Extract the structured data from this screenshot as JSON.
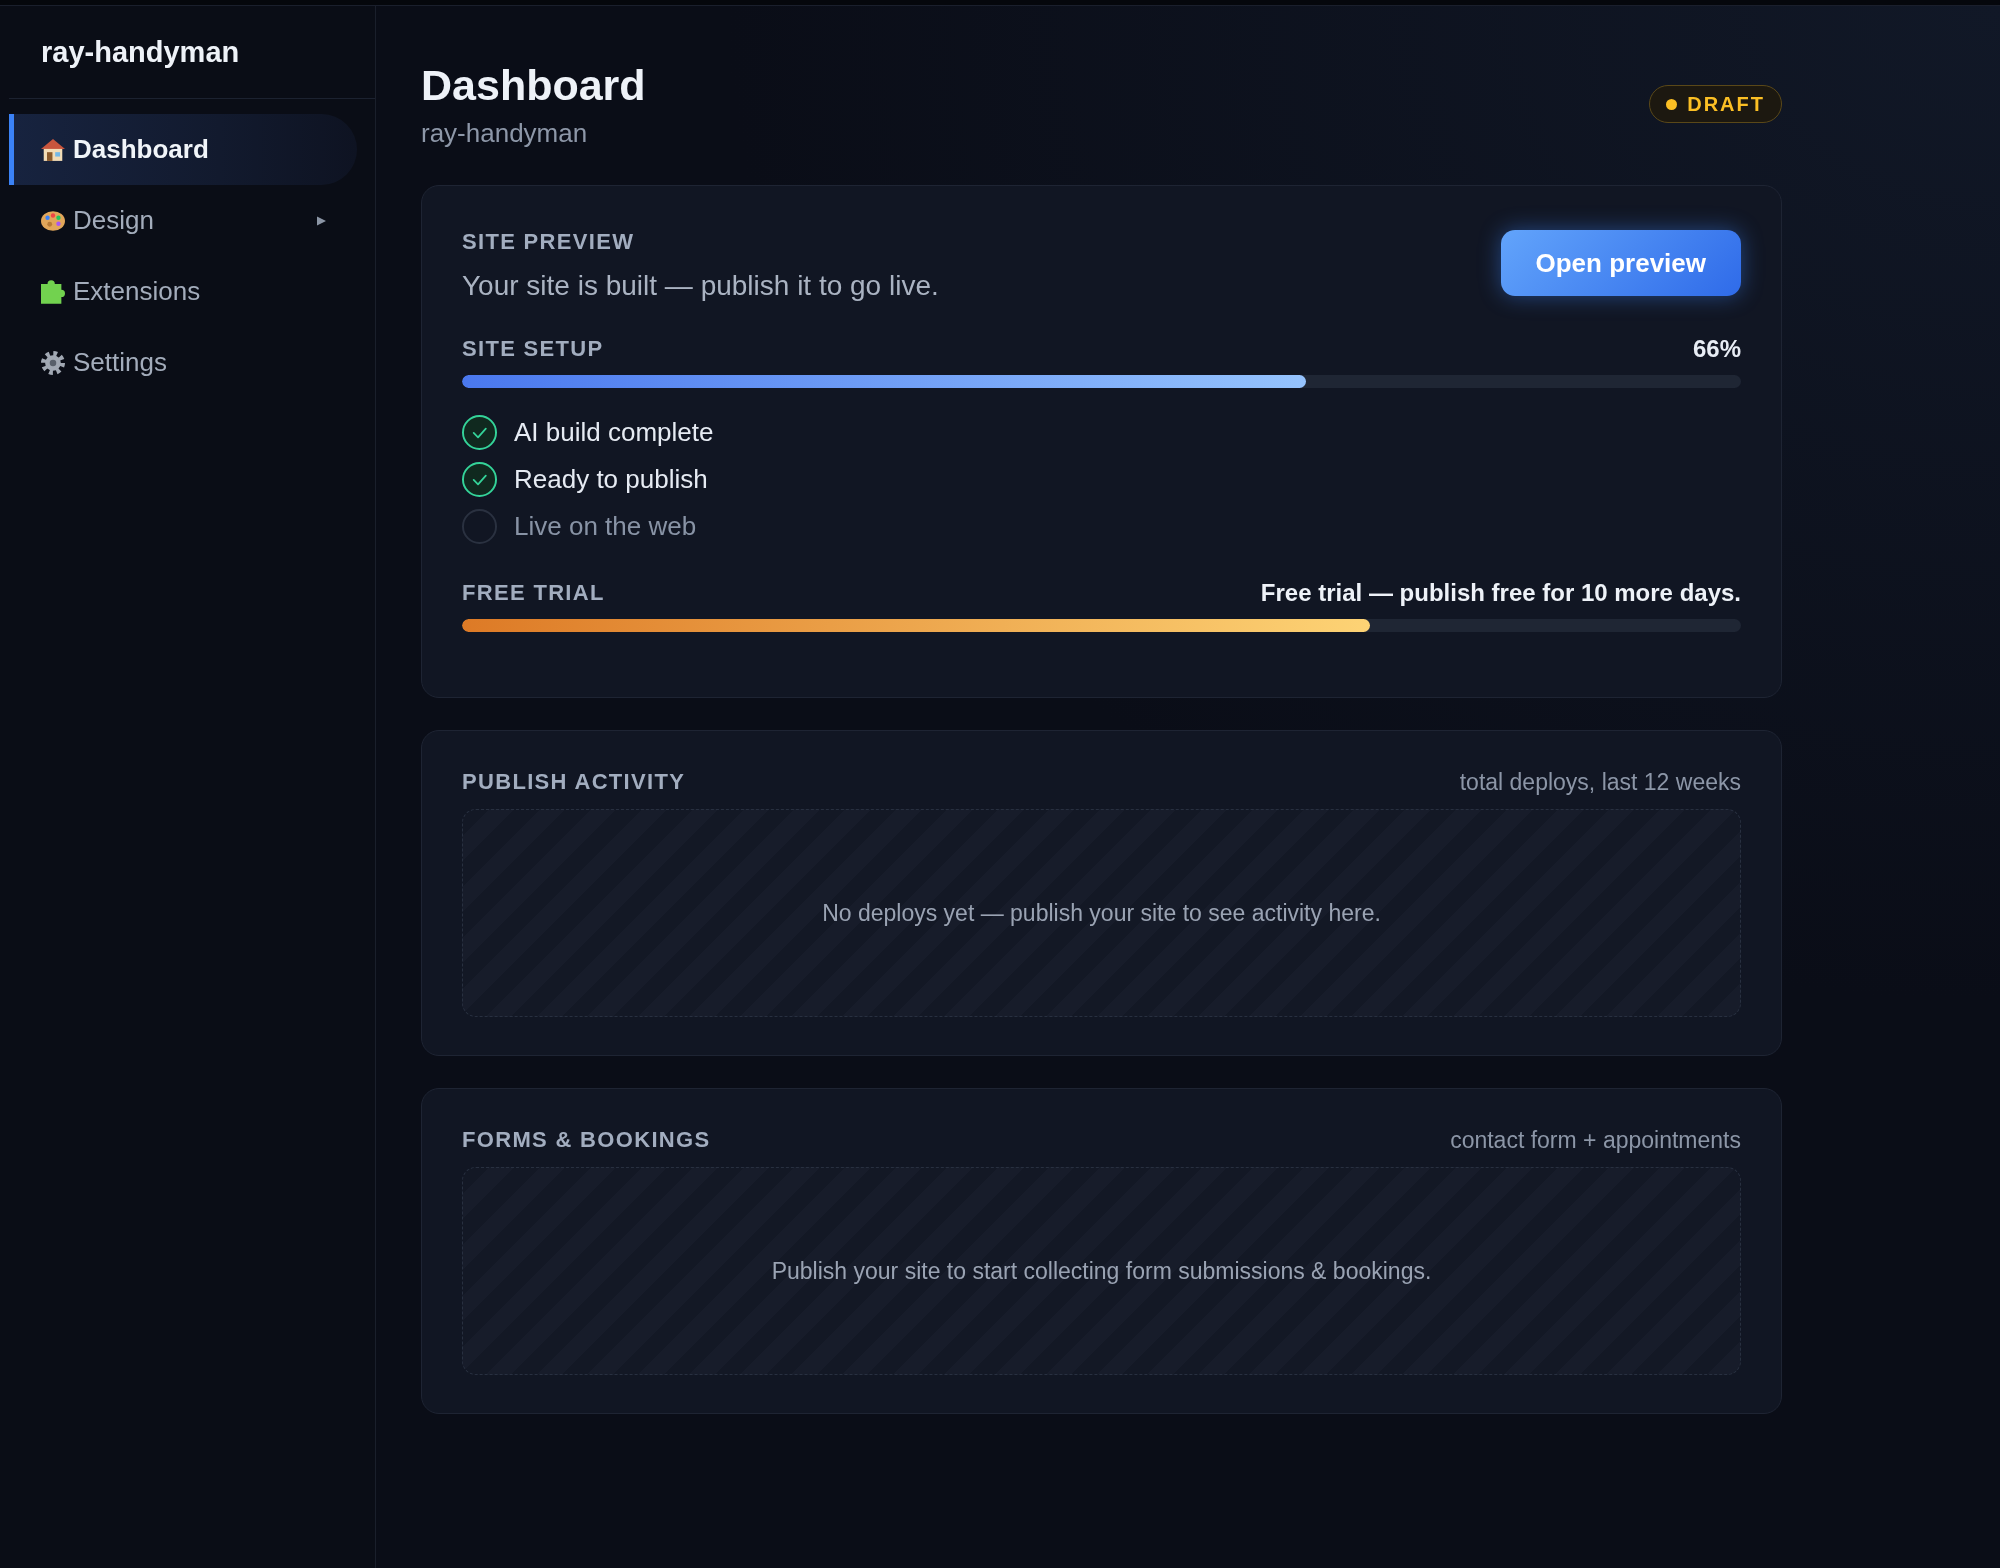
{
  "sidebar": {
    "brand": "ray-handyman",
    "items": [
      {
        "label": "Dashboard",
        "selected": true
      },
      {
        "label": "Design",
        "selected": false,
        "expanded": false
      },
      {
        "label": "Extensions",
        "selected": false
      },
      {
        "label": "Settings",
        "selected": false
      }
    ]
  },
  "header": {
    "title": "Dashboard",
    "subtitle": "ray-handyman",
    "status_badge": "DRAFT"
  },
  "site_preview": {
    "heading": "SITE PREVIEW",
    "description": "Your site is built — publish it to go live.",
    "button": "Open preview",
    "setup": {
      "label": "SITE SETUP",
      "reading": "66%",
      "level": 0.66,
      "steps": [
        {
          "label": "AI build complete",
          "checked": true
        },
        {
          "label": "Ready to publish",
          "checked": true
        },
        {
          "label": "Live on the web",
          "checked": false
        }
      ]
    },
    "trial": {
      "label": "FREE TRIAL",
      "note": "Free trial — publish free for 10 more days.",
      "level": 0.71
    }
  },
  "panels": [
    {
      "heading": "PUBLISH ACTIVITY",
      "caption": "total deploys, last 12 weeks",
      "empty_message": "No deploys yet — publish your site to see activity here."
    },
    {
      "heading": "FORMS & BOOKINGS",
      "caption": "contact form + appointments",
      "empty_message": "Publish your site to start collecting form submissions & bookings."
    }
  ]
}
